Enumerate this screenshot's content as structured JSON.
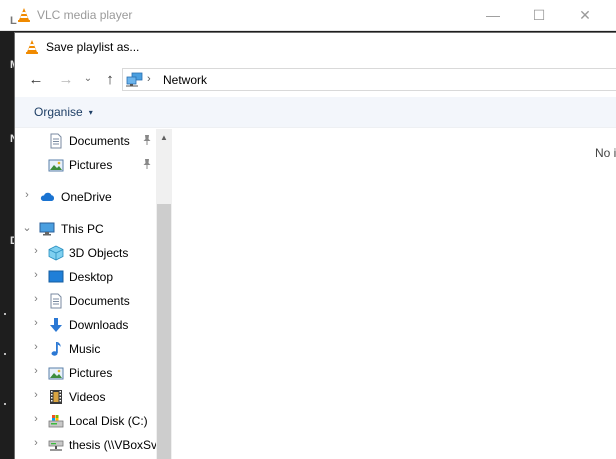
{
  "vlc": {
    "title": "VLC media player",
    "controls": {
      "minimize": "—",
      "maximize": "☐",
      "close": "✕"
    },
    "strip_chars": [
      "L",
      "M",
      "N",
      "D"
    ]
  },
  "dialog": {
    "title": "Save playlist as...",
    "address": {
      "separator": "›",
      "crumb": "Network"
    },
    "nav_buttons": {
      "back": "←",
      "forward": "→",
      "recent": "⌄",
      "up": "↑"
    },
    "toolbar": {
      "organise": "Organise",
      "caret": "▾"
    },
    "nav_pane": {
      "quick_access": [
        {
          "label": "Documents",
          "icon": "documents-icon",
          "pinned": true
        },
        {
          "label": "Pictures",
          "icon": "pictures-icon",
          "pinned": true
        }
      ],
      "onedrive": {
        "label": "OneDrive",
        "icon": "cloud-icon",
        "expander": "›"
      },
      "this_pc": {
        "label": "This PC",
        "icon": "computer-icon",
        "expander": "⌄",
        "children": [
          {
            "label": "3D Objects",
            "icon": "3d-objects-icon",
            "expander": "›"
          },
          {
            "label": "Desktop",
            "icon": "desktop-icon",
            "expander": "›"
          },
          {
            "label": "Documents",
            "icon": "documents-icon",
            "expander": "›"
          },
          {
            "label": "Downloads",
            "icon": "downloads-icon",
            "expander": "›"
          },
          {
            "label": "Music",
            "icon": "music-icon",
            "expander": "›"
          },
          {
            "label": "Pictures",
            "icon": "pictures-icon",
            "expander": "›"
          },
          {
            "label": "Videos",
            "icon": "videos-icon",
            "expander": "›"
          },
          {
            "label": "Local Disk (C:)",
            "icon": "local-disk-icon",
            "expander": "›"
          },
          {
            "label": "thesis (\\\\VBoxSv",
            "icon": "network-drive-icon",
            "expander": "›"
          }
        ]
      }
    },
    "scrollbar": {
      "up_arrow": "▲"
    },
    "content": {
      "empty_text": "No i"
    }
  },
  "colors": {
    "vlc_orange": "#f08a00",
    "toolbar_bg": "#f3f6fb",
    "organise_text": "#1e3f66",
    "folder_blue": "#2b78d4",
    "scrollbar_track": "#f0f0f0",
    "scrollbar_thumb": "#cdcdcd"
  }
}
